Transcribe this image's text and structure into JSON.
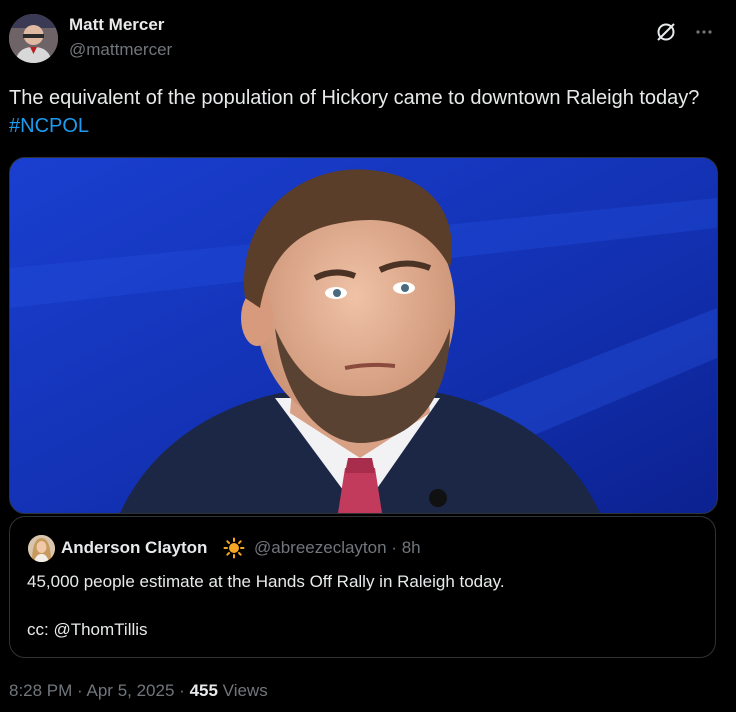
{
  "author": {
    "name": "Matt Mercer",
    "handle": "@mattmercer"
  },
  "tweet": {
    "text": "The equivalent of the population of Hickory came to downtown Raleigh today?",
    "hashtag": "#NCPOL"
  },
  "quoted": {
    "name": "Anderson Clayton",
    "handle": "@abreezeclayton",
    "sep": "·",
    "time": "8h",
    "text": "45,000 people estimate at the Hands Off Rally in Raleigh today.",
    "cc": "cc: @ThomTillis"
  },
  "footer": {
    "time": "8:28 PM",
    "date": "Apr 5, 2025",
    "sep": "·",
    "views_count": "455",
    "views_label": "Views"
  },
  "icons": {
    "grok": "grok-icon",
    "more": "more-icon",
    "sun": "sun-emoji-icon"
  },
  "colors": {
    "background": "#000000",
    "text": "#e7e9ea",
    "muted": "#71767b",
    "link": "#1d9bf0",
    "border": "#2f3336"
  }
}
